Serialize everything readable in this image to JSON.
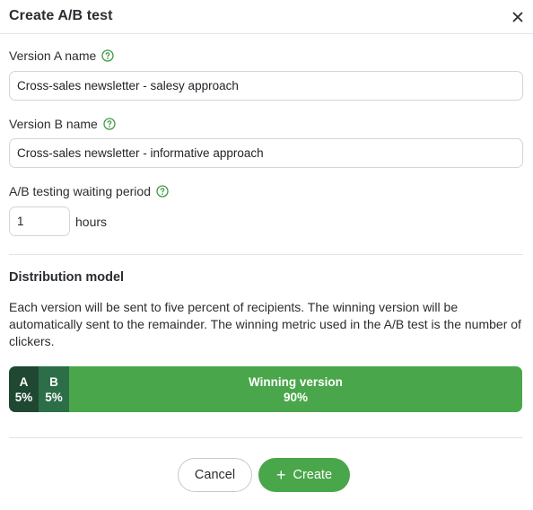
{
  "dialog": {
    "title": "Create A/B test",
    "close_icon": "close-icon"
  },
  "form": {
    "version_a": {
      "label": "Version A name",
      "value": "Cross-sales newsletter - salesy approach",
      "help_icon": "help-circle-icon"
    },
    "version_b": {
      "label": "Version B name",
      "value": "Cross-sales newsletter - informative approach",
      "help_icon": "help-circle-icon"
    },
    "waiting_period": {
      "label": "A/B testing waiting period",
      "value": "1",
      "unit": "hours",
      "help_icon": "help-circle-icon"
    }
  },
  "distribution": {
    "title": "Distribution model",
    "description": "Each version will be sent to five percent of recipients. The winning version will be automatically sent to the remainder. The winning metric used in the A/B test is the number of clickers.",
    "segments": [
      {
        "label": "A",
        "percent": "5%",
        "color": "#1f4731"
      },
      {
        "label": "B",
        "percent": "5%",
        "color": "#2c6e48"
      },
      {
        "label": "Winning version",
        "percent": "90%",
        "color": "#4aa64a"
      }
    ]
  },
  "footer": {
    "cancel_label": "Cancel",
    "create_label": "Create",
    "create_icon": "plus-icon"
  },
  "colors": {
    "accent": "#4aa64a",
    "help_icon": "#3f9a45"
  }
}
